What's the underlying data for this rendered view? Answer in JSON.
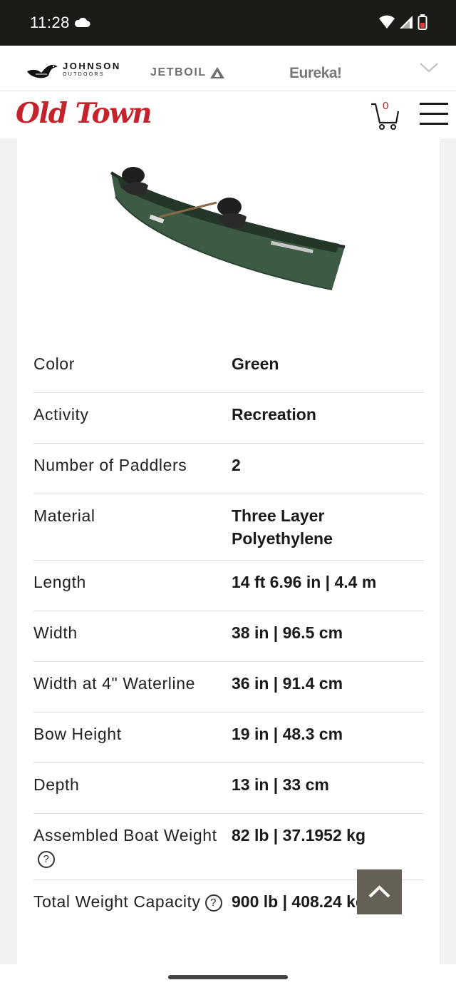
{
  "status_bar": {
    "time": "11:28"
  },
  "brands": {
    "johnson_main": "JOHNSON",
    "johnson_sub": "OUTDOORS",
    "jetboil": "JETBOIL",
    "eureka": "Eureka!"
  },
  "header": {
    "logo": "Old Town",
    "cart_count": "0"
  },
  "specs": [
    {
      "label": "Color",
      "value": "Green"
    },
    {
      "label": "Activity",
      "value": "Recreation"
    },
    {
      "label": "Number of Paddlers",
      "value": "2"
    },
    {
      "label": "Material",
      "value": "Three Layer Polyethylene"
    },
    {
      "label": "Length",
      "value": "14 ft 6.96 in | 4.4 m"
    },
    {
      "label": "Width",
      "value": "38 in | 96.5 cm"
    },
    {
      "label": "Width at 4\" Waterline",
      "value": "36 in | 91.4 cm"
    },
    {
      "label": "Bow Height",
      "value": "19 in | 48.3 cm"
    },
    {
      "label": "Depth",
      "value": "13 in | 33 cm"
    },
    {
      "label": "Assembled Boat Weight",
      "value": "82 lb | 37.1952 kg"
    },
    {
      "label": "Total Weight Capacity",
      "value": "900 lb | 408.24 kg"
    }
  ],
  "help_glyph": "?",
  "colors": {
    "brand_red": "#c4232b",
    "canoe_green": "#3d5a45",
    "back_to_top": "#656055"
  }
}
